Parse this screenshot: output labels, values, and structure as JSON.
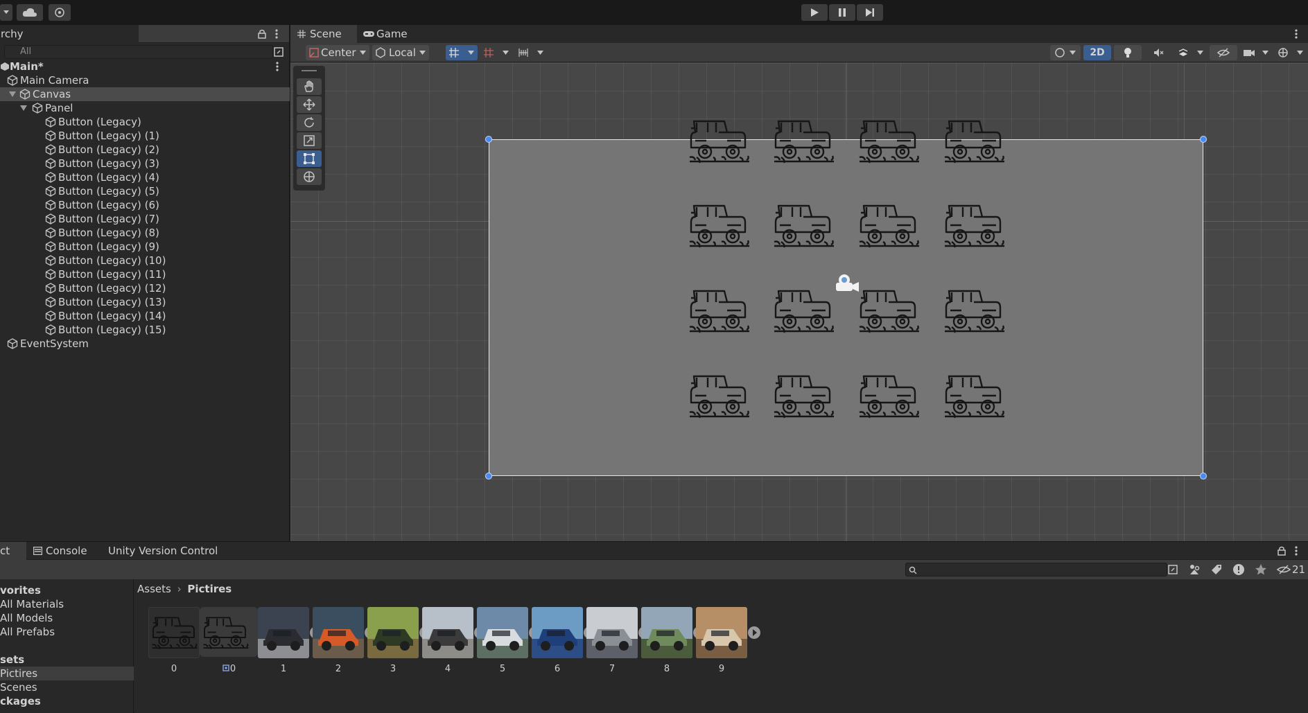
{
  "toolbar": {
    "play_icon": "play-icon",
    "pause_icon": "pause-icon",
    "step_icon": "step-icon"
  },
  "hierarchy": {
    "tab_label": "rchy",
    "search_placeholder": "All",
    "scene_name": "Main*",
    "items": [
      {
        "label": "Main Camera",
        "depth": 1,
        "selected": false,
        "expand": "none"
      },
      {
        "label": "Canvas",
        "depth": 1,
        "selected": true,
        "expand": "open"
      },
      {
        "label": "Panel",
        "depth": 2,
        "selected": false,
        "expand": "open"
      },
      {
        "label": "Button (Legacy)",
        "depth": 3
      },
      {
        "label": "Button (Legacy) (1)",
        "depth": 3
      },
      {
        "label": "Button (Legacy) (2)",
        "depth": 3
      },
      {
        "label": "Button (Legacy) (3)",
        "depth": 3
      },
      {
        "label": "Button (Legacy) (4)",
        "depth": 3
      },
      {
        "label": "Button (Legacy) (5)",
        "depth": 3
      },
      {
        "label": "Button (Legacy) (6)",
        "depth": 3
      },
      {
        "label": "Button (Legacy) (7)",
        "depth": 3
      },
      {
        "label": "Button (Legacy) (8)",
        "depth": 3
      },
      {
        "label": "Button (Legacy) (9)",
        "depth": 3
      },
      {
        "label": "Button (Legacy) (10)",
        "depth": 3
      },
      {
        "label": "Button (Legacy) (11)",
        "depth": 3
      },
      {
        "label": "Button (Legacy) (12)",
        "depth": 3
      },
      {
        "label": "Button (Legacy) (13)",
        "depth": 3
      },
      {
        "label": "Button (Legacy) (14)",
        "depth": 3
      },
      {
        "label": "Button (Legacy) (15)",
        "depth": 3
      },
      {
        "label": "EventSystem",
        "depth": 1
      }
    ]
  },
  "scene": {
    "tabs": [
      {
        "label": "Scene",
        "icon": "grid-icon"
      },
      {
        "label": "Game",
        "icon": "gamepad-icon"
      }
    ],
    "pivot_label": "Center",
    "space_label": "Local",
    "mode_2d_label": "2D"
  },
  "project": {
    "tabs": [
      {
        "label": "ct"
      },
      {
        "label": "Console"
      },
      {
        "label": "Unity Version Control"
      }
    ],
    "hidden_count": "21",
    "tree": [
      {
        "label": "vorites",
        "bold": true
      },
      {
        "label": "All Materials"
      },
      {
        "label": "All Models"
      },
      {
        "label": "All Prefabs"
      },
      {
        "label": "",
        "spacer": true
      },
      {
        "label": "sets",
        "bold": true
      },
      {
        "label": "Pictires",
        "selected": true
      },
      {
        "label": "Scenes"
      },
      {
        "label": "ckages",
        "bold": true
      }
    ],
    "breadcrumb": {
      "root": "Assets",
      "current": "Pictires"
    },
    "assets": [
      {
        "label": "0",
        "kind": "icon"
      },
      {
        "label": "0",
        "kind": "icon-selected"
      },
      {
        "label": "1",
        "kind": "photo",
        "colors": [
          "#3b4250",
          "#2b2c31",
          "#8c8e92"
        ]
      },
      {
        "label": "2",
        "kind": "photo",
        "colors": [
          "#3b4e60",
          "#d65a28",
          "#6b5b4a"
        ]
      },
      {
        "label": "3",
        "kind": "photo",
        "colors": [
          "#8aa04c",
          "#2f3a25",
          "#7a6a40"
        ]
      },
      {
        "label": "4",
        "kind": "photo",
        "colors": [
          "#b7c0c9",
          "#3b3b3b",
          "#8d8c88"
        ]
      },
      {
        "label": "5",
        "kind": "photo",
        "colors": [
          "#6d8aa8",
          "#d8dcde",
          "#5d6e62"
        ]
      },
      {
        "label": "6",
        "kind": "photo",
        "colors": [
          "#6c9bc4",
          "#1f3f7a",
          "#2c4d86"
        ]
      },
      {
        "label": "7",
        "kind": "photo",
        "colors": [
          "#c9ccd0",
          "#8a8f96",
          "#5d6068"
        ]
      },
      {
        "label": "8",
        "kind": "photo",
        "colors": [
          "#93a6b8",
          "#6f8a5c",
          "#4b5c3c"
        ]
      },
      {
        "label": "9",
        "kind": "photo",
        "colors": [
          "#b78f66",
          "#d8c7ad",
          "#7a5e43"
        ]
      }
    ]
  }
}
